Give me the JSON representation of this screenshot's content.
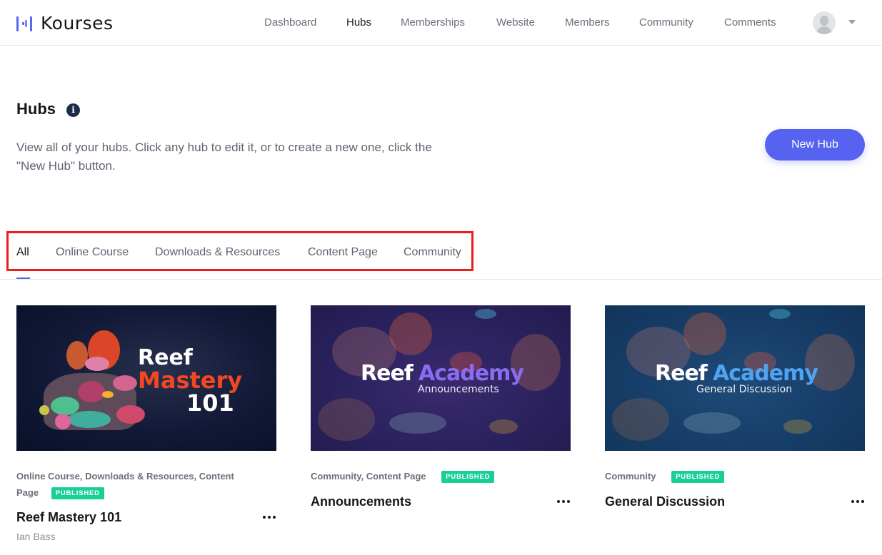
{
  "app": {
    "brand_name": "Kourses",
    "accent_color": "#5563f0"
  },
  "nav": {
    "items": [
      {
        "label": "Dashboard",
        "active": false
      },
      {
        "label": "Hubs",
        "active": true
      },
      {
        "label": "Memberships",
        "active": false
      },
      {
        "label": "Website",
        "active": false
      },
      {
        "label": "Members",
        "active": false
      },
      {
        "label": "Community",
        "active": false
      },
      {
        "label": "Comments",
        "active": false
      }
    ],
    "avatar_icon": "user-avatar-icon",
    "caret_icon": "caret-down-icon"
  },
  "page": {
    "title": "Hubs",
    "info_icon_glyph": "i",
    "description": "View all of your hubs. Click any hub to edit it, or to create a new one, click the \"New Hub\" button.",
    "new_hub_label": "New Hub"
  },
  "tabs": {
    "items": [
      {
        "label": "All",
        "active": true
      },
      {
        "label": "Online Course",
        "active": false
      },
      {
        "label": "Downloads & Resources",
        "active": false
      },
      {
        "label": "Content Page",
        "active": false
      },
      {
        "label": "Community",
        "active": false
      }
    ],
    "highlight_color": "#ee1c1c"
  },
  "hubs": [
    {
      "title": "Reef Mastery 101",
      "types": "Online Course, Downloads & Resources, Content Page",
      "types_line1": "Online Course, Downloads & Resources, Content",
      "types_line2": "Page",
      "status": "PUBLISHED",
      "author": "Ian Bass",
      "thumbnail": {
        "line1": "Reef",
        "line2": "Mastery",
        "line3": "101"
      }
    },
    {
      "title": "Announcements",
      "types": "Community, Content Page",
      "status": "PUBLISHED",
      "thumbnail": {
        "word1": "Reef",
        "word2": "Academy",
        "subtitle": "Announcements"
      }
    },
    {
      "title": "General Discussion",
      "types": "Community",
      "status": "PUBLISHED",
      "thumbnail": {
        "word1": "Reef",
        "word2": "Academy",
        "subtitle": "General Discussion"
      }
    }
  ],
  "colors": {
    "published_badge": "#17cf97",
    "title_text": "#16171b",
    "muted_text": "#6b6f7b"
  }
}
